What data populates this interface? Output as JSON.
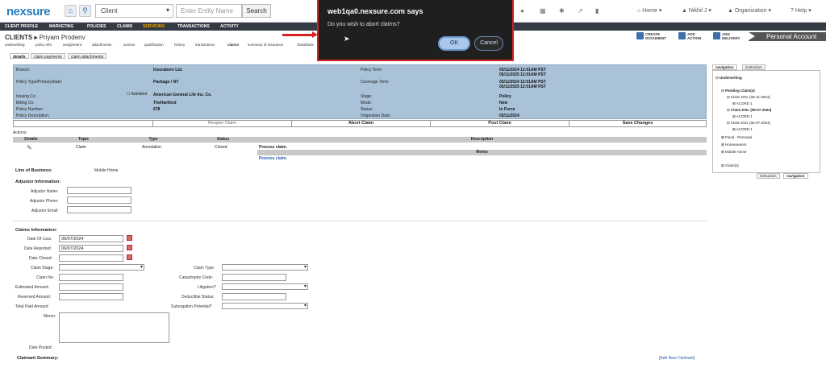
{
  "app": {
    "logo": "nexsure",
    "search_select": "Client",
    "entity_placeholder": "Enter Entity Name",
    "search_label": "Search",
    "menu_home": "Home",
    "menu_user": "Nikhil J",
    "menu_org": "Organization",
    "menu_help": "Help"
  },
  "nav": [
    "CLIENT PROFILE",
    "MARKETING",
    "POLICIES",
    "CLAIMS",
    "SERVICING",
    "TRANSACTIONS",
    "ACTIVITY"
  ],
  "crumb": {
    "section": "CLIENTS",
    "name": "Priyam Prodenv"
  },
  "subtabs": [
    "underwriting",
    "policy info",
    "assignment",
    "attachments",
    "actions",
    "qualification",
    "history",
    "transactions",
    "claims",
    "summary of insurance",
    "classifieds"
  ],
  "actions": {
    "create": "CREATE DOCUMENT",
    "add_action": "ADD ACTION",
    "add_delivery": "ADD DELIVERY",
    "personal": "Personal Account"
  },
  "tabs": [
    "details",
    "claim payments",
    "claim attachments"
  ],
  "policy": {
    "branch_l": "Branch:",
    "branch_v": "Insurabore Ltd.",
    "ptype_l": "Policy Type/PrimaryState:",
    "ptype_v": "Package / NY",
    "issuing_l": "Issuing Co:",
    "admitted": "Admitted",
    "issuing_v": "American General Life Ins. Co.",
    "billing_l": "Billing Co:",
    "billing_v": "TheHartford",
    "pnum_l": "Policy Number:",
    "pnum_v": "678",
    "pdesc_l": "Policy Description:",
    "term_l": "Policy Term:",
    "term_v1": "05/11/2024  12:01AM PST",
    "term_v2": "05/11/2025  12:01AM PST",
    "cov_l": "Coverage Term:",
    "cov_v1": "05/11/2024  12:01AM PST",
    "cov_v2": "05/11/2025  12:01AM PST",
    "stage_l": "Stage:",
    "stage_v": "Policy",
    "mode_l": "Mode:",
    "mode_v": "New",
    "status_l": "Status:",
    "status_v": "In Force",
    "orig_l": "Origination Date:",
    "orig_v": "05/11/2024"
  },
  "buttons": {
    "reopen": "Reopen Claim",
    "abort": "Abort Claim",
    "post": "Post Claim",
    "save": "Save Changes"
  },
  "actions_tbl": {
    "label": "Actions:",
    "headers": [
      "Details",
      "Topic",
      "Type",
      "Status",
      "Description"
    ],
    "row": [
      "Claim",
      "Annotation",
      "Closed",
      "Process claim."
    ],
    "memo_h": "Memo",
    "memo_v": "Process claim."
  },
  "lob": {
    "label": "Line of Business:",
    "value": "Mobile Home"
  },
  "adjuster": {
    "title": "Adjustor Information:",
    "name": "Adjustor Name:",
    "phone": "Adjustor Phone:",
    "email": "Adjustor Email:"
  },
  "claims": {
    "title": "Claims Information:",
    "dol": "Date Of Loss:",
    "dol_v": "06/07/2024",
    "reported": "Date Reported:",
    "reported_v": "06/07/2024",
    "closed": "Date Closed:",
    "stage": "Claim Stage:",
    "type": "Claim Type:",
    "no": "Claim No:",
    "cat": "Catastrophe Code:",
    "est": "Estimated Amount:",
    "lit": "Litigation?",
    "res": "Reserved Amount:",
    "ded": "Deductible Status:",
    "paid": "Total Paid Amount:",
    "sub": "Subrogation Potential?",
    "memo": "Memo:",
    "posted": "Date Posted:"
  },
  "claimant": {
    "title": "Claimant Summary:",
    "add": "[Add New Claimant]"
  },
  "rightpanel": {
    "tabs": [
      "navigation",
      "instruction"
    ],
    "tabs_bottom": [
      "instruction",
      "navigation"
    ],
    "tree": [
      "Underwriting",
      "Pending Claim(s)",
      "Claim DOL (05-11-2024)",
      "ACORD 1",
      "Claim DOL (06-07-2024)",
      "ACORD 1",
      "Claim DOL (06-07-2024)",
      "ACORD 1",
      "Flood - Personal",
      "Homeowners",
      "Mobile Home",
      "Claim(s)"
    ]
  },
  "dialog": {
    "title": "web1qa0.nexsure.com says",
    "message": "Do you wish to abort claims?",
    "ok": "OK",
    "cancel": "Cancel"
  }
}
